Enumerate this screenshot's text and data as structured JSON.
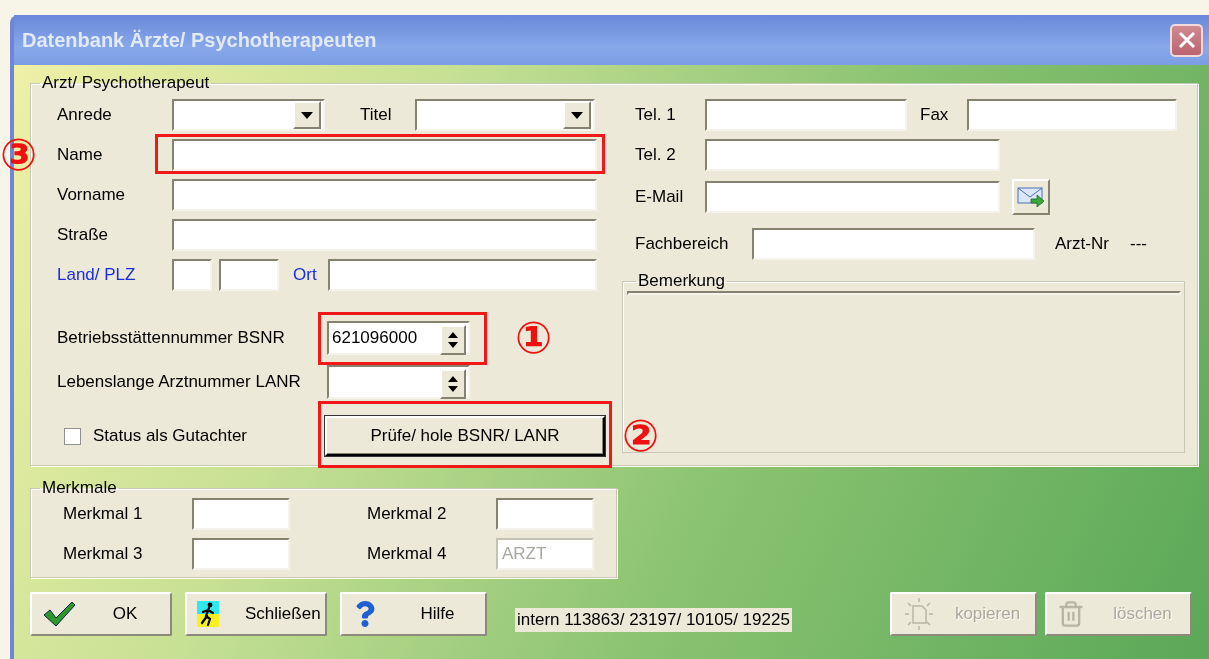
{
  "window": {
    "title": "Datenbank Ärzte/ Psychotherapeuten"
  },
  "doctor": {
    "legend": "Arzt/ Psychotherapeut"
  },
  "left_rows": [
    {
      "kind": "combo_pair",
      "label": "Anrede",
      "second_label": "Titel",
      "highlighted": false
    },
    {
      "kind": "text",
      "label": "Name",
      "highlighted": true,
      "annotation": "③"
    },
    {
      "kind": "text",
      "label": "Vorname",
      "highlighted": false
    },
    {
      "kind": "text",
      "label": "Straße",
      "highlighted": false
    },
    {
      "kind": "address",
      "label": "Land/ PLZ",
      "second_label": "Ort",
      "highlighted": false
    }
  ],
  "number_rows": [
    {
      "label": "Betriebsstättennummer BSNR",
      "value": "621096000",
      "highlighted": true,
      "annotation": "①"
    },
    {
      "label": "Lebenslange Arztnummer LANR",
      "highlighted": false
    }
  ],
  "expert_checkbox": {
    "label": "Status als Gutachter",
    "checked": false
  },
  "check_button": {
    "label": "Prüfe/ hole BSNR/ LANR",
    "highlighted": true,
    "annotation": "②"
  },
  "contact": {
    "tel1": "Tel. 1",
    "fax": "Fax",
    "tel2": "Tel. 2",
    "email": "E-Mail",
    "department": "Fachbereich",
    "doctor_no_label": "Arzt-Nr",
    "doctor_no": "---"
  },
  "remarks": {
    "legend": "Bemerkung"
  },
  "features": {
    "legend": "Merkmale",
    "items": [
      {
        "label": "Merkmal 1",
        "disabled": false
      },
      {
        "label": "Merkmal 2",
        "disabled": false
      },
      {
        "label": "Merkmal 3",
        "disabled": false
      },
      {
        "label": "Merkmal 4",
        "value": "ARZT",
        "disabled": true
      }
    ]
  },
  "buttons": [
    {
      "kind": "ok",
      "label": "OK",
      "disabled": false
    },
    {
      "kind": "close",
      "label": "Schließen",
      "disabled": false
    },
    {
      "kind": "help",
      "label": "Hilfe",
      "disabled": false
    }
  ],
  "status": "intern 113863/ 23197/ 10105/ 19225",
  "record_buttons": [
    {
      "kind": "copy",
      "label": "kopieren",
      "disabled": true
    },
    {
      "kind": "delete",
      "label": "löschen",
      "disabled": true
    }
  ]
}
